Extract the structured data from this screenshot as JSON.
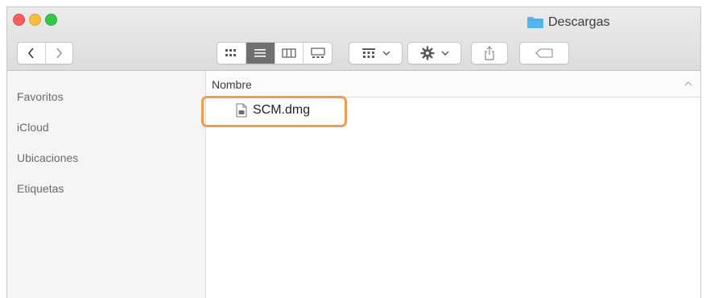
{
  "window": {
    "title": "Descargas"
  },
  "toolbar": {
    "back_icon": "chevron-left-icon",
    "forward_icon": "chevron-right-icon",
    "view_modes": [
      "icon-view",
      "list-view",
      "column-view",
      "gallery-view"
    ],
    "active_view": "list-view",
    "arrange_icon": "arrange-icon",
    "action_icon": "gear-icon",
    "share_icon": "share-icon",
    "tag_icon": "tag-icon"
  },
  "sidebar": {
    "items": [
      {
        "label": "Favoritos"
      },
      {
        "label": "iCloud"
      },
      {
        "label": "Ubicaciones"
      },
      {
        "label": "Etiquetas"
      }
    ]
  },
  "list": {
    "column_header": "Nombre",
    "files": [
      {
        "name": "SCM.dmg"
      }
    ]
  },
  "colors": {
    "highlight": "#f29a4d",
    "close": "#fc605c",
    "minimize": "#fdbc40",
    "maximize": "#34c84a",
    "folder": "#55b6ee"
  }
}
